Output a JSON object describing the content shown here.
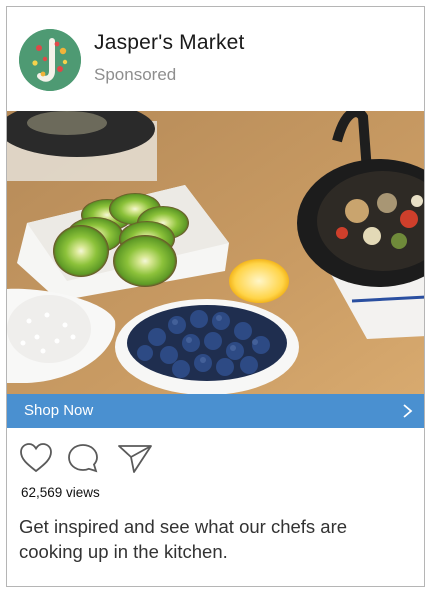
{
  "post": {
    "brand_name": "Jasper's Market",
    "sponsored_label": "Sponsored",
    "cta_label": "Shop Now",
    "views": "62,569 views",
    "caption": "Get inspired and see what our chefs are cooking up in the kitchen."
  },
  "icons": {
    "like": "heart-icon",
    "comment": "comment-icon",
    "share": "send-icon",
    "cta": "chevron-right-icon"
  },
  "colors": {
    "cta_background": "#4a90d0",
    "avatar_background": "#4e9a73",
    "border": "#b5b5b5"
  }
}
